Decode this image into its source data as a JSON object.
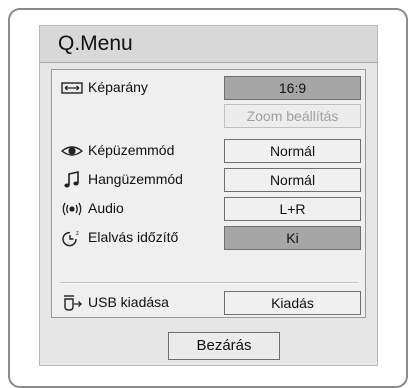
{
  "menu": {
    "title": "Q.Menu",
    "items": [
      {
        "icon": "aspect-ratio-icon",
        "label": "Képarány",
        "value": "16:9",
        "highlighted": true
      },
      {
        "icon": "zoom-icon",
        "label": "",
        "value": "Zoom beállítás",
        "disabled": true
      },
      {
        "icon": "eye-icon",
        "label": "Képüzemmód",
        "value": "Normál"
      },
      {
        "icon": "music-note-icon",
        "label": "Hangüzemmód",
        "value": "Normál"
      },
      {
        "icon": "audio-waves-icon",
        "label": "Audio",
        "value": "L+R"
      },
      {
        "icon": "sleep-timer-icon",
        "label": "Elalvás időzítő",
        "value": "Ki",
        "highlighted": true
      },
      {
        "icon": "usb-eject-icon",
        "label": "USB kiadása",
        "value": "Kiadás"
      }
    ],
    "close_label": "Bezárás"
  }
}
